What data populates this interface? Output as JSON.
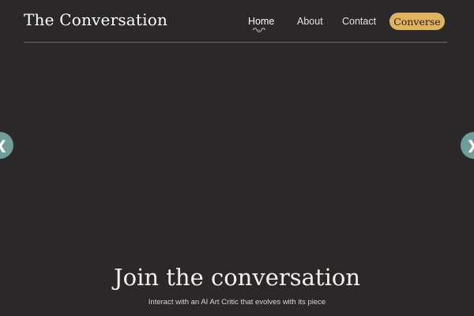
{
  "header": {
    "brand": "The Conversation",
    "nav": {
      "home": "Home",
      "about": "About",
      "contact": "Contact"
    },
    "cta_label": "Converse"
  },
  "carousel": {
    "prev_icon": "chevron-left-icon",
    "next_icon": "chevron-right-icon",
    "prev_glyph": "❮",
    "next_glyph": "❯"
  },
  "hero": {
    "title": "Join the conversation",
    "subtitle": "Interact with an AI Art Critic that evolves with its piece"
  },
  "colors": {
    "background": "#2b2829",
    "accent": "#e0b361",
    "carousel_button": "#6f9d9a",
    "divider": "#6b6868"
  }
}
